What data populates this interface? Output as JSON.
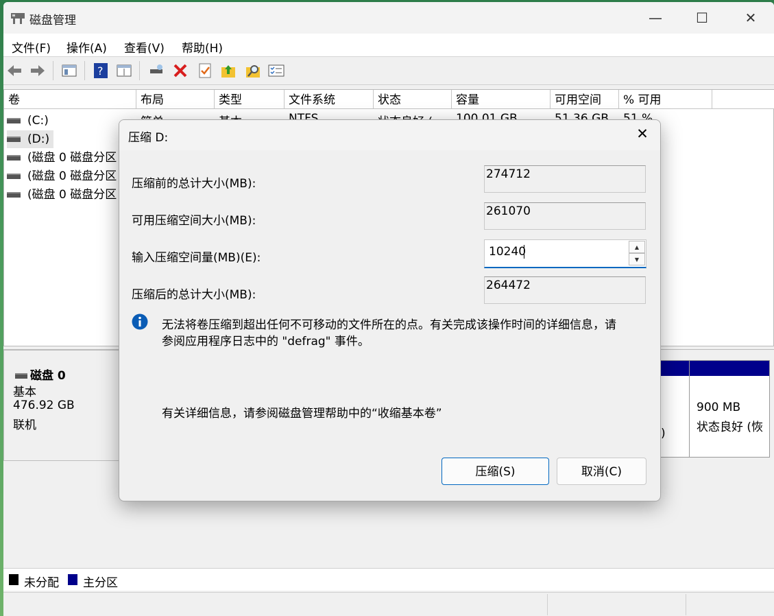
{
  "window": {
    "title": "磁盘管理",
    "controls": {
      "minimize": "—",
      "maximize": "☐",
      "close": "✕"
    }
  },
  "menu": [
    "文件(F)",
    "操作(A)",
    "查看(V)",
    "帮助(H)"
  ],
  "toolbar": {
    "icons": [
      "back-arrow-icon",
      "forward-arrow-icon",
      "console-tree-icon",
      "help-icon",
      "properties-view-icon",
      "connect-drive-icon",
      "delete-icon",
      "check-icon",
      "up-folder-icon",
      "search-folder-icon",
      "list-settings-icon"
    ],
    "colors": {
      "delete": "#d81e1e",
      "help": "#1c3f9e",
      "folder": "#f2c232"
    }
  },
  "table": {
    "headers": [
      "卷",
      "布局",
      "类型",
      "文件系统",
      "状态",
      "容量",
      "可用空间",
      "% 可用"
    ],
    "rows": [
      {
        "vol": "(C:)",
        "layout": "简单",
        "type": "基本",
        "fs": "NTFS",
        "status": "状态良好 (",
        "capacity": "100.01 GB",
        "free": "51.36 GB",
        "pct": "51 %"
      },
      {
        "vol": "(D:)"
      },
      {
        "vol": "(磁盘 0 磁盘分区"
      },
      {
        "vol": "(磁盘 0 磁盘分区"
      },
      {
        "vol": "(磁盘 0 磁盘分区"
      }
    ]
  },
  "disk0": {
    "name": "磁盘 0",
    "type": "基本",
    "size": "476.92 GB",
    "state": "联机"
  },
  "partition_right": {
    "size": "900 MB",
    "status": "状态良好 (恢",
    "paren": ")"
  },
  "legend": [
    {
      "label": "未分配",
      "color": "#000000"
    },
    {
      "label": "主分区",
      "color": "#00008b"
    }
  ],
  "dialog": {
    "title": "压缩 D:",
    "close": "✕",
    "fields": {
      "total_before_label": "压缩前的总计大小(MB):",
      "total_before_value": "274712",
      "available_label": "可用压缩空间大小(MB):",
      "available_value": "261070",
      "input_label": "输入压缩空间量(MB)(E):",
      "input_value": "10240",
      "total_after_label": "压缩后的总计大小(MB):",
      "total_after_value": "264472"
    },
    "info_line1": "无法将卷压缩到超出任何不可移动的文件所在的点。有关完成该操作时间的详细信息，请",
    "info_line2": "参阅应用程序日志中的 \"defrag\" 事件。",
    "help_text": "有关详细信息，请参阅磁盘管理帮助中的“收缩基本卷”",
    "ok_button": "压缩(S)",
    "cancel_button": "取消(C)"
  }
}
